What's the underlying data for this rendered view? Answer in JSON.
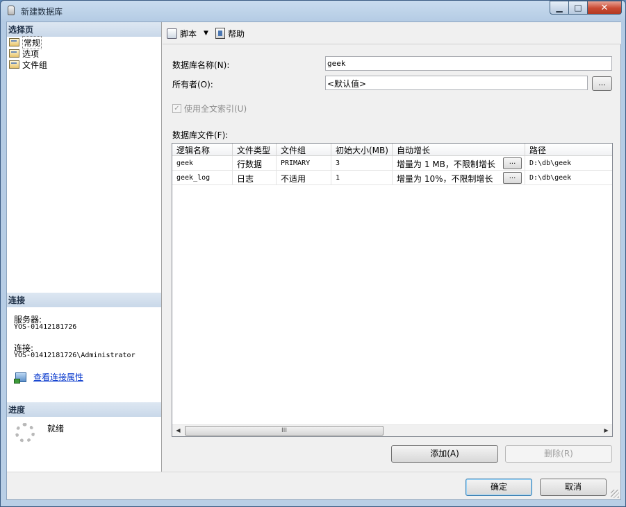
{
  "window": {
    "title": "新建数据库",
    "min_glyph": "▁",
    "max_glyph": "□",
    "close_glyph": "✕"
  },
  "left_pane": {
    "select_page_header": "选择页",
    "pages": [
      {
        "label": "常规",
        "icon": "page-icon"
      },
      {
        "label": "选项",
        "icon": "page-icon"
      },
      {
        "label": "文件组",
        "icon": "page-icon"
      }
    ],
    "connection_header": "连接",
    "server_label": "服务器:",
    "server_value": "YOS-01412181726",
    "connection_label": "连接:",
    "connection_value": "YOS-01412181726\\Administrator",
    "view_connection_link": "查看连接属性",
    "progress_header": "进度",
    "progress_status": "就绪"
  },
  "toolbar": {
    "script_label": "脚本",
    "dropdown_glyph": "▼",
    "help_label": "帮助"
  },
  "form": {
    "db_name_label": "数据库名称(N):",
    "db_name_value": "geek",
    "owner_label": "所有者(O):",
    "owner_value": "<默认值>",
    "browse_label": "...",
    "fulltext_label": "使用全文索引(U)",
    "fulltext_checked": true,
    "files_label": "数据库文件(F):"
  },
  "files_table": {
    "columns": [
      "逻辑名称",
      "文件类型",
      "文件组",
      "初始大小(MB)",
      "自动增长",
      "路径"
    ],
    "rows": [
      {
        "logical_name": "geek",
        "file_type": "行数据",
        "filegroup": "PRIMARY",
        "initial_size": "3",
        "autogrowth": "增量为 1 MB，不限制增长",
        "path": "D:\\db\\geek"
      },
      {
        "logical_name": "geek_log",
        "file_type": "日志",
        "filegroup": "不适用",
        "initial_size": "1",
        "autogrowth": "增量为 10%，不限制增长",
        "path": "D:\\db\\geek"
      }
    ],
    "ellipsis": "...",
    "scroll_left": "◀",
    "scroll_right": "▶",
    "thumb_grip": "III"
  },
  "buttons": {
    "add": "添加(A)",
    "remove": "删除(R)",
    "ok": "确定",
    "cancel": "取消"
  }
}
